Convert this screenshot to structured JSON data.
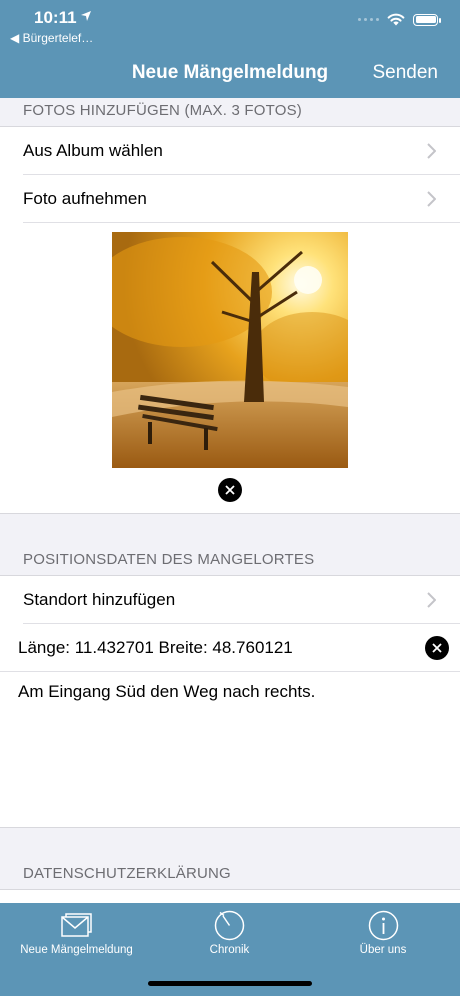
{
  "status_bar": {
    "time": "10:11",
    "back_app": "◀ Bürgertelef…"
  },
  "nav": {
    "title": "Neue Mängelmeldung",
    "send_label": "Senden"
  },
  "photos": {
    "section_title": "FOTOS HINZUFÜGEN (MAX. 3 FOTOS)",
    "album_label": "Aus Album wählen",
    "camera_label": "Foto aufnehmen"
  },
  "position": {
    "section_title": "POSITIONSDATEN DES MANGELORTES",
    "add_location_label": "Standort hinzufügen",
    "coordinates": "Länge: 11.432701 Breite: 48.760121",
    "description": "Am Eingang Süd den Weg nach rechts."
  },
  "privacy": {
    "section_title": "DATENSCHUTZERKLÄRUNG"
  },
  "tabs": [
    {
      "label": "Neue Mängelmeldung",
      "icon": "envelope-icon"
    },
    {
      "label": "Chronik",
      "icon": "history-icon"
    },
    {
      "label": "Über uns",
      "icon": "info-icon"
    }
  ],
  "colors": {
    "bar": "#5c95b6",
    "background": "#f2f2f7"
  }
}
